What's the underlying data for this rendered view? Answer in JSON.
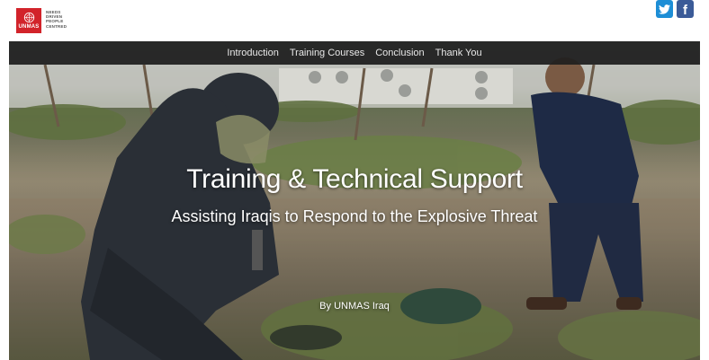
{
  "header": {
    "logo": {
      "emblem_text": "UNMAS",
      "tagline": [
        "NEEDS",
        "DRIVEN",
        "PEOPLE",
        "CENTRED"
      ]
    },
    "social": {
      "twitter_icon": "twitter-icon",
      "facebook_icon": "facebook-icon",
      "facebook_glyph": "f"
    }
  },
  "nav": {
    "items": [
      {
        "label": "Introduction"
      },
      {
        "label": "Training Courses"
      },
      {
        "label": "Conclusion"
      },
      {
        "label": "Thank You"
      }
    ]
  },
  "hero": {
    "title": "Training & Technical Support",
    "subtitle": "Assisting Iraqis to Respond to the Explosive Threat",
    "byline": "By UNMAS Iraq"
  },
  "colors": {
    "brand_red": "#d2232a",
    "twitter_blue": "#1d8ed6",
    "facebook_blue": "#3b5b98",
    "nav_bg": "#1e1e1e"
  }
}
